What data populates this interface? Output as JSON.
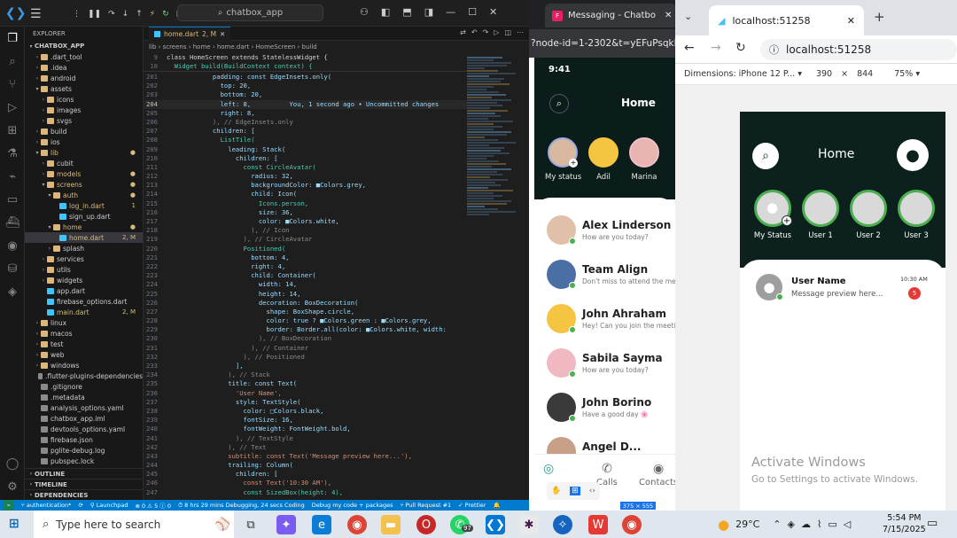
{
  "vscode": {
    "search": "chatbox_app",
    "explorer_label": "EXPLORER",
    "project": "CHATBOX_APP",
    "tree": [
      {
        "name": ".dart_tool",
        "indent": 1,
        "type": "folder"
      },
      {
        "name": ".idea",
        "indent": 1,
        "type": "folder"
      },
      {
        "name": "android",
        "indent": 1,
        "type": "folder"
      },
      {
        "name": "assets",
        "indent": 1,
        "type": "folder",
        "open": true
      },
      {
        "name": "icons",
        "indent": 2,
        "type": "folder"
      },
      {
        "name": "images",
        "indent": 2,
        "type": "folder"
      },
      {
        "name": "svgs",
        "indent": 2,
        "type": "folder"
      },
      {
        "name": "build",
        "indent": 1,
        "type": "folder"
      },
      {
        "name": "ios",
        "indent": 1,
        "type": "folder"
      },
      {
        "name": "lib",
        "indent": 1,
        "type": "folder",
        "open": true,
        "badge": "●"
      },
      {
        "name": "cubit",
        "indent": 2,
        "type": "folder"
      },
      {
        "name": "models",
        "indent": 2,
        "type": "folder",
        "badge": "●"
      },
      {
        "name": "screens",
        "indent": 2,
        "type": "folder",
        "open": true,
        "badge": "●"
      },
      {
        "name": "auth",
        "indent": 3,
        "type": "folder",
        "open": true,
        "badge": "●"
      },
      {
        "name": "log_in.dart",
        "indent": 4,
        "type": "dart",
        "badge": "1"
      },
      {
        "name": "sign_up.dart",
        "indent": 4,
        "type": "dart"
      },
      {
        "name": "home",
        "indent": 3,
        "type": "folder",
        "open": true,
        "badge": "●"
      },
      {
        "name": "home.dart",
        "indent": 4,
        "type": "dart",
        "badge": "2, M",
        "selected": true
      },
      {
        "name": "splash",
        "indent": 3,
        "type": "folder"
      },
      {
        "name": "services",
        "indent": 2,
        "type": "folder"
      },
      {
        "name": "utils",
        "indent": 2,
        "type": "folder"
      },
      {
        "name": "widgets",
        "indent": 2,
        "type": "folder"
      },
      {
        "name": "app.dart",
        "indent": 2,
        "type": "dart"
      },
      {
        "name": "firebase_options.dart",
        "indent": 2,
        "type": "dart"
      },
      {
        "name": "main.dart",
        "indent": 2,
        "type": "dart",
        "badge": "2, M"
      },
      {
        "name": "linux",
        "indent": 1,
        "type": "folder"
      },
      {
        "name": "macos",
        "indent": 1,
        "type": "folder"
      },
      {
        "name": "test",
        "indent": 1,
        "type": "folder"
      },
      {
        "name": "web",
        "indent": 1,
        "type": "folder"
      },
      {
        "name": "windows",
        "indent": 1,
        "type": "folder"
      },
      {
        "name": ".flutter-plugins-dependencies",
        "indent": 1,
        "type": "file"
      },
      {
        "name": ".gitignore",
        "indent": 1,
        "type": "file"
      },
      {
        "name": ".metadata",
        "indent": 1,
        "type": "file"
      },
      {
        "name": "analysis_options.yaml",
        "indent": 1,
        "type": "file"
      },
      {
        "name": "chatbox_app.iml",
        "indent": 1,
        "type": "file"
      },
      {
        "name": "devtools_options.yaml",
        "indent": 1,
        "type": "file"
      },
      {
        "name": "firebase.json",
        "indent": 1,
        "type": "file"
      },
      {
        "name": "pglite-debug.log",
        "indent": 1,
        "type": "file"
      },
      {
        "name": "pubspec.lock",
        "indent": 1,
        "type": "file"
      }
    ],
    "outline": "OUTLINE",
    "timeline": "TIMELINE",
    "dependencies": "DEPENDENCIES",
    "tab_label": "home.dart",
    "tab_mod": "2, M",
    "breadcrumb": "lib › screens › home › home.dart › HomeScreen › build",
    "sticky1": "class HomeScreen extends StatelessWidget {",
    "sticky2": "  Widget build(BuildContext context) {",
    "code_lines": [
      {
        "n": "201",
        "t": "            padding: const EdgeInsets.only("
      },
      {
        "n": "202",
        "t": "              top: 20,"
      },
      {
        "n": "203",
        "t": "              bottom: 20,"
      },
      {
        "n": "204",
        "t": "              left: 8,          You, 1 second ago • Uncommitted changes"
      },
      {
        "n": "205",
        "t": "              right: 8,"
      },
      {
        "n": "206",
        "t": "            ), // EdgeInsets.only"
      },
      {
        "n": "207",
        "t": "            children: ["
      },
      {
        "n": "208",
        "t": "              ListTile("
      },
      {
        "n": "209",
        "t": "                leading: Stack("
      },
      {
        "n": "210",
        "t": "                  children: ["
      },
      {
        "n": "211",
        "t": "                    const CircleAvatar("
      },
      {
        "n": "212",
        "t": "                      radius: 32,"
      },
      {
        "n": "213",
        "t": "                      backgroundColor: ■Colors.grey,"
      },
      {
        "n": "214",
        "t": "                      child: Icon("
      },
      {
        "n": "215",
        "t": "                        Icons.person,"
      },
      {
        "n": "216",
        "t": "                        size: 36,"
      },
      {
        "n": "217",
        "t": "                        color: ■Colors.white,"
      },
      {
        "n": "218",
        "t": "                      ), // Icon"
      },
      {
        "n": "219",
        "t": "                    ), // CircleAvatar"
      },
      {
        "n": "220",
        "t": "                    Positioned("
      },
      {
        "n": "221",
        "t": "                      bottom: 4,"
      },
      {
        "n": "222",
        "t": "                      right: 4,"
      },
      {
        "n": "223",
        "t": "                      child: Container("
      },
      {
        "n": "224",
        "t": "                        width: 14,"
      },
      {
        "n": "225",
        "t": "                        height: 14,"
      },
      {
        "n": "226",
        "t": "                        decoration: BoxDecoration("
      },
      {
        "n": "227",
        "t": "                          shape: BoxShape.circle,"
      },
      {
        "n": "228",
        "t": "                          color: true ? ■Colors.green : ■Colors.grey,"
      },
      {
        "n": "229",
        "t": "                          border: Border.all(color: ■Colors.white, width:"
      },
      {
        "n": "230",
        "t": "                        ), // BoxDecoration"
      },
      {
        "n": "231",
        "t": "                      ), // Container"
      },
      {
        "n": "232",
        "t": "                    ), // Positioned"
      },
      {
        "n": "233",
        "t": "                  ],"
      },
      {
        "n": "234",
        "t": "                ), // Stack"
      },
      {
        "n": "235",
        "t": "                title: const Text("
      },
      {
        "n": "236",
        "t": "                  'User Name',"
      },
      {
        "n": "237",
        "t": "                  style: TextStyle("
      },
      {
        "n": "238",
        "t": "                    color: □Colors.black,"
      },
      {
        "n": "239",
        "t": "                    fontSize: 16,"
      },
      {
        "n": "240",
        "t": "                    fontWeight: FontWeight.bold,"
      },
      {
        "n": "241",
        "t": "                  ), // TextStyle"
      },
      {
        "n": "242",
        "t": "                ), // Text"
      },
      {
        "n": "243",
        "t": "                subtitle: const Text('Message preview here...'),"
      },
      {
        "n": "244",
        "t": "                trailing: Column("
      },
      {
        "n": "245",
        "t": "                  children: ["
      },
      {
        "n": "246",
        "t": "                    const Text('10:30 AM'),"
      },
      {
        "n": "247",
        "t": "                    const SizedBox(height: 4),"
      }
    ],
    "status": {
      "branch": "authentication*",
      "launchpad": "Launchpad",
      "problems": "⊗ 0 ⚠ 5 ⓘ 0",
      "debug_time": "8 hrs 29 mins Debugging, 24 secs Coding",
      "debug_mode": "Debug my code + packages",
      "pr": "Pull Request #1",
      "prettier": "Prettier"
    }
  },
  "messaging": {
    "tab_title": "Messaging - Chatbo",
    "url": "?node-id=1-2302&t=yEFuPsqkFu",
    "time": "9:41",
    "title": "Home",
    "stories": [
      "My status",
      "Adil",
      "Marina"
    ],
    "chats": [
      {
        "name": "Alex Linderson",
        "preview": "How are you today?"
      },
      {
        "name": "Team Align",
        "preview": "Don't miss to attend the meeting"
      },
      {
        "name": "John Ahraham",
        "preview": "Hey! Can you join the meeting?"
      },
      {
        "name": "Sabila Sayma",
        "preview": "How are you today?"
      },
      {
        "name": "John Borino",
        "preview": "Have a good day 🌸"
      },
      {
        "name": "Angel D...",
        "preview": ""
      }
    ],
    "nav": [
      "Message",
      "Calls",
      "Contacts"
    ],
    "dimension_badge": "375 × 555"
  },
  "localhost": {
    "tab_title": "localhost:51258",
    "url": "localhost:51258",
    "dimensions_label": "Dimensions: iPhone 12 P...",
    "width": "390",
    "x": "×",
    "height": "844",
    "zoom": "75%",
    "app_title": "Home",
    "stories": [
      "My Status",
      "User 1",
      "User 2",
      "User 3"
    ],
    "chat_name": "User Name",
    "chat_preview": "Message preview here...",
    "chat_time": "10:30 AM",
    "chat_badge": "5",
    "activate_title": "Activate Windows",
    "activate_sub": "Go to Settings to activate Windows."
  },
  "taskbar": {
    "search_placeholder": "Type here to search",
    "weather": "29°C",
    "time": "5:54 PM",
    "date": "7/15/2025",
    "badge": "97"
  }
}
